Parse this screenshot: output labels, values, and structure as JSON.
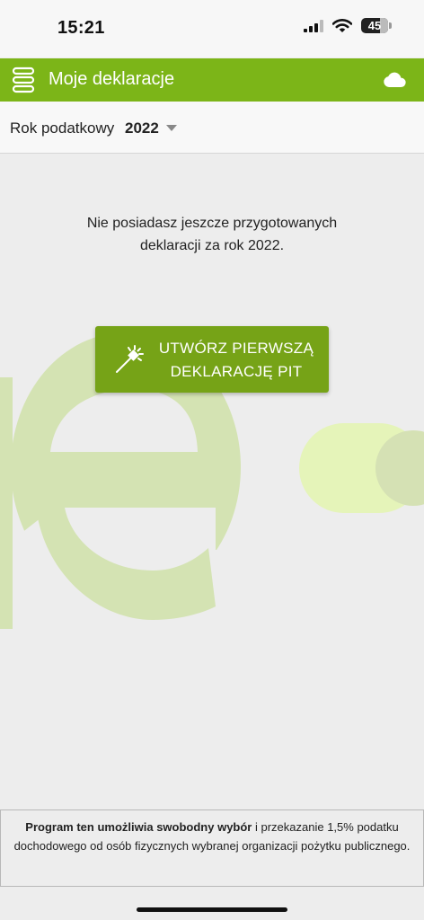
{
  "status_bar": {
    "time": "15:21",
    "battery": "45",
    "icons": [
      "signal-icon",
      "wifi-icon",
      "battery-icon"
    ]
  },
  "header": {
    "title": "Moje deklaracje",
    "menu_icon": "menu-icon",
    "cloud_icon": "cloud-icon",
    "color": "#7cb518"
  },
  "year_selector": {
    "label": "Rok podatkowy",
    "value": "2022",
    "caret_icon": "chevron-down-icon"
  },
  "main": {
    "empty_message": "Nie posiadasz jeszcze przygotowanych deklaracji za rok 2022.",
    "create_button": {
      "line1": "UTWÓRZ PIERWSZĄ",
      "line2": "DEKLARACJĘ PIT",
      "icon": "magic-wand-icon",
      "color": "#76a317"
    }
  },
  "footer": {
    "bold_text": "Program ten umożliwia swobodny wybór",
    "text": " i przekazanie 1,5% podatku dochodowego od osób fizycznych wybranej organizacji pożytku publicznego."
  }
}
